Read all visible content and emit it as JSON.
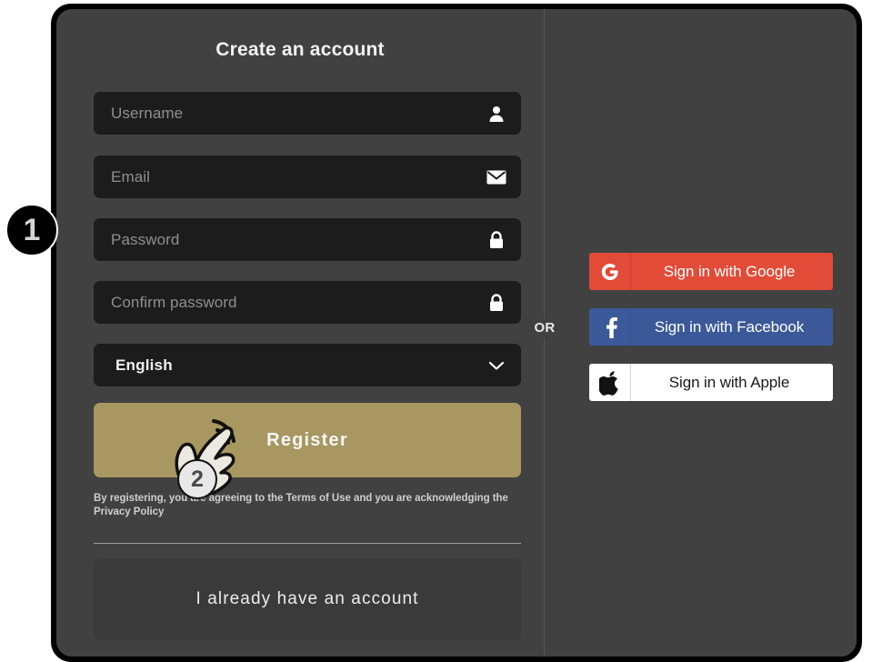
{
  "panel": {
    "background_color": "#414141",
    "border_color": "#000000",
    "divider_label": "OR"
  },
  "form": {
    "title": "Create an account",
    "fields": [
      {
        "name": "username",
        "placeholder": "Username",
        "value": "",
        "icon": "person-icon"
      },
      {
        "name": "email",
        "placeholder": "Email",
        "value": "",
        "icon": "envelope-icon"
      },
      {
        "name": "password",
        "placeholder": "Password",
        "value": "",
        "icon": "lock-icon"
      },
      {
        "name": "confirm_password",
        "placeholder": "Confirm password",
        "value": "",
        "icon": "lock-icon"
      }
    ],
    "language": {
      "label": "English",
      "selected": "English",
      "chevron_icon": "chevron-down-icon"
    },
    "register_label": "Register",
    "register_color": "#a89761",
    "terms_text": "By registering, you are agreeing to the Terms of Use and you are acknowledging the Privacy Policy",
    "existing_account_label": "I already have an account"
  },
  "social": {
    "buttons": [
      {
        "name": "google",
        "label": "Sign in with Google",
        "icon": "google-g-icon",
        "color": "#e14b38",
        "text_color": "#ffffff"
      },
      {
        "name": "facebook",
        "label": "Sign in with Facebook",
        "icon": "facebook-f-icon",
        "color": "#3b5998",
        "text_color": "#ffffff"
      },
      {
        "name": "apple",
        "label": "Sign in with Apple",
        "icon": "apple-logo-icon",
        "color": "#ffffff",
        "text_color": "#1a1a1a"
      }
    ]
  },
  "annotations": {
    "step_one": "1",
    "step_two": "2"
  }
}
